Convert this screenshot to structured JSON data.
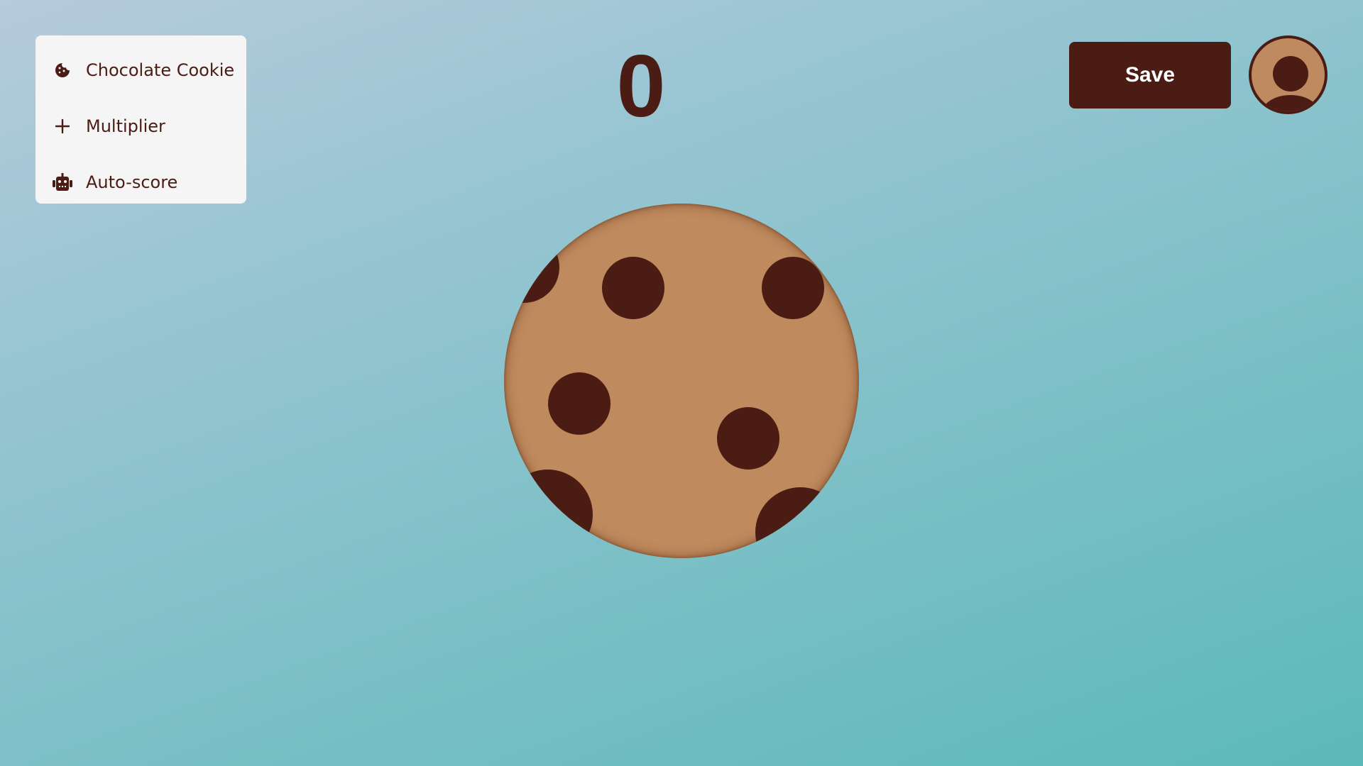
{
  "menu": {
    "items": [
      {
        "label": "Chocolate Cookie",
        "icon": "cookie-icon"
      },
      {
        "label": "Multiplier",
        "icon": "plus-icon"
      },
      {
        "label": "Auto-score",
        "icon": "robot-icon"
      }
    ]
  },
  "score": {
    "value": "0"
  },
  "toolbar": {
    "save_label": "Save"
  },
  "user": {
    "avatar_icon": "user-avatar-icon"
  },
  "colors": {
    "primary": "#4a1c14",
    "cookie": "#bf8a5e",
    "menu_background": "#f5f5f5",
    "save_text": "#ffffff"
  }
}
